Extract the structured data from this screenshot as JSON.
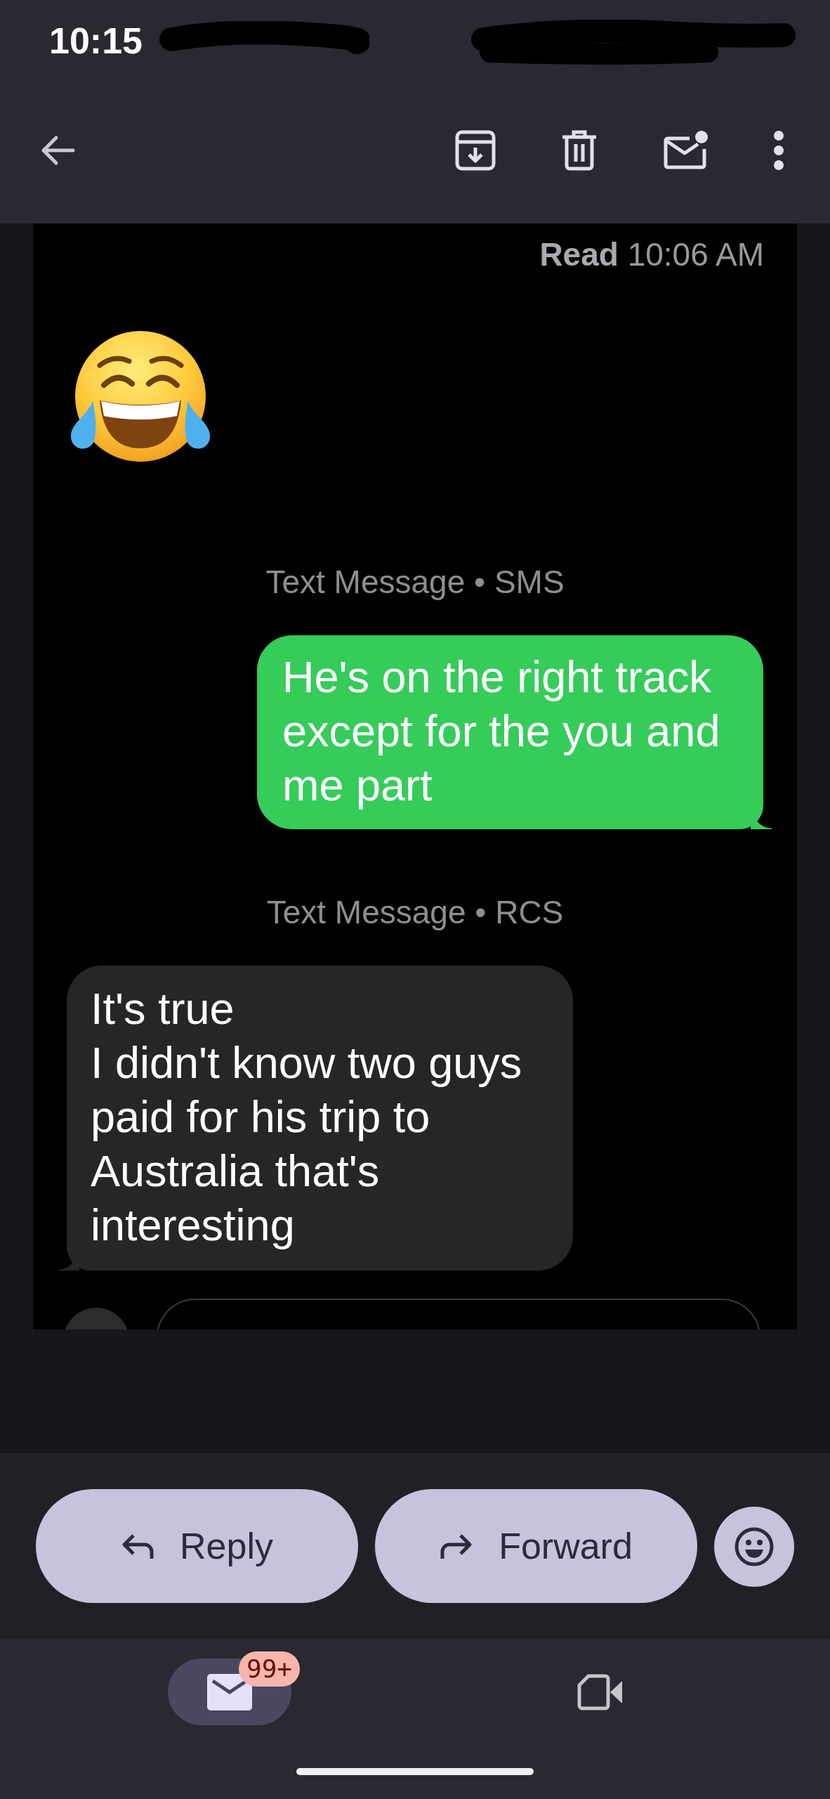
{
  "status_bar": {
    "time": "10:15"
  },
  "thread": {
    "read_receipt": "**Read** 10:06 AM",
    "items": [
      {
        "kind": "emoji",
        "incoming": true
      },
      {
        "kind": "divider",
        "text": "Text Message • SMS"
      },
      {
        "kind": "bubble",
        "incoming": false,
        "text": "He's on the right track except for the you and me part"
      },
      {
        "kind": "divider",
        "text": "Text Message • RCS"
      },
      {
        "kind": "bubble",
        "incoming": true,
        "text": "It's true\nI didn't know two guys paid for his trip to Australia that's interesting"
      }
    ]
  },
  "actions": [
    {
      "kind": "reply",
      "label": "Reply"
    },
    {
      "kind": "forward",
      "label": "Forward"
    }
  ],
  "bottom_nav": {
    "items": [
      {
        "kind": "mail",
        "selected": true,
        "badge": "99+"
      },
      {
        "kind": "video",
        "selected": false
      }
    ]
  }
}
